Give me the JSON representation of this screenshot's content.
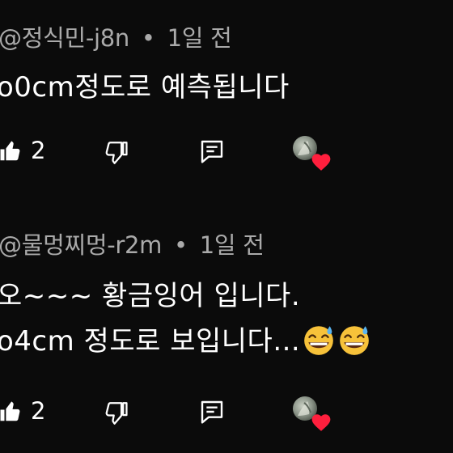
{
  "comments": [
    {
      "author": "@정식민-j8n",
      "separator": "•",
      "time": "1일 전",
      "lines": [
        "o0cm정도로 예측됩니다"
      ],
      "likes": "2",
      "icons": [
        "thumb-up-icon",
        "thumb-down-icon",
        "reply-icon",
        "creator-avatar",
        "heart-icon"
      ]
    },
    {
      "author": "@물멍찌멍-r2m",
      "separator": "•",
      "time": "1일 전",
      "lines": [
        "오~~~ 황금잉어 입니다.",
        "o4cm 정도로 보입니다..."
      ],
      "likes": "2",
      "icons": [
        "thumb-up-icon",
        "thumb-down-icon",
        "reply-icon",
        "creator-avatar",
        "heart-icon"
      ],
      "emoji": [
        "grinning-sweat-emoji",
        "grinning-sweat-emoji"
      ]
    }
  ],
  "colors": {
    "background": "#0b0b0b",
    "meta_text": "#aaaaaa",
    "body_text": "#ffffff",
    "heart": "#ff1f3d"
  }
}
